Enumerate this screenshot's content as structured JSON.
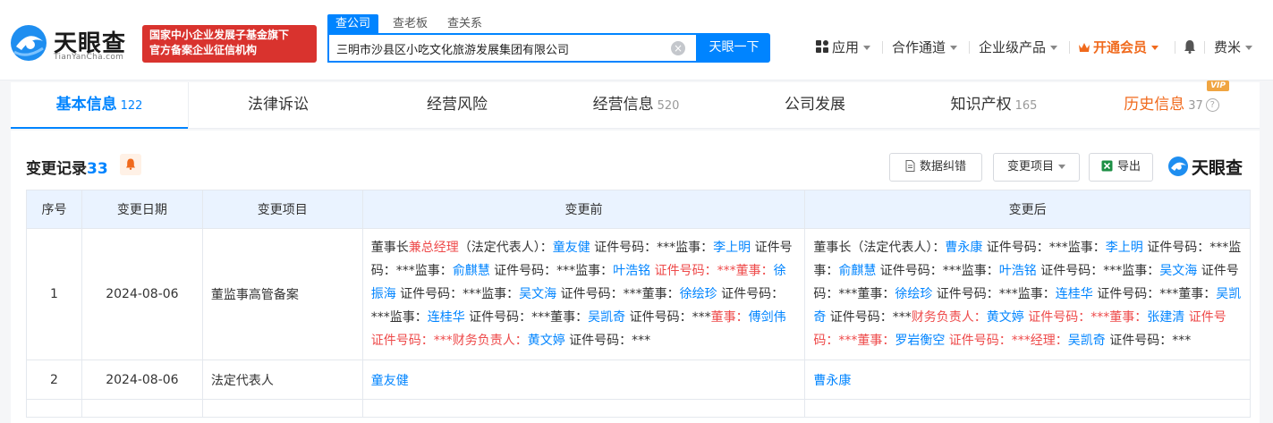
{
  "brand": {
    "name": "天眼查",
    "sub": "TianYanCha.com",
    "badge_line1": "国家中小企业发展子基金旗下",
    "badge_line2": "官方备案企业征信机构"
  },
  "search": {
    "tabs": [
      "查公司",
      "查老板",
      "查关系"
    ],
    "value": "三明市沙县区小吃文化旅游发展集团有限公司",
    "button": "天眼一下"
  },
  "nav": {
    "apps": "应用",
    "channels": "合作通道",
    "enterprise": "企业级产品",
    "vip": "开通会员",
    "user": "费米"
  },
  "tabs": [
    {
      "label": "基本信息",
      "count": "122"
    },
    {
      "label": "法律诉讼",
      "count": ""
    },
    {
      "label": "经营风险",
      "count": ""
    },
    {
      "label": "经营信息",
      "count": "520"
    },
    {
      "label": "公司发展",
      "count": ""
    },
    {
      "label": "知识产权",
      "count": "165"
    },
    {
      "label": "历史信息",
      "count": "37",
      "tag": "VIP"
    }
  ],
  "section": {
    "title": "变更记录",
    "count": "33",
    "btn_correct": "数据纠错",
    "btn_items": "变更项目",
    "btn_export": "导出",
    "brand": "天眼查"
  },
  "table": {
    "headers": [
      "序号",
      "变更日期",
      "变更项目",
      "变更前",
      "变更后"
    ],
    "rows": [
      {
        "idx": "1",
        "date": "2024-08-06",
        "item": "董监事高管备案"
      },
      {
        "idx": "2",
        "date": "2024-08-06",
        "item": "法定代表人",
        "before": "童友健",
        "after": "曹永康"
      }
    ]
  },
  "row1_before": [
    {
      "t": "董事长",
      "c": ""
    },
    {
      "t": "兼总经理",
      "c": "red"
    },
    {
      "t": "（法定代表人）：",
      "c": ""
    },
    {
      "t": "童友健",
      "c": "lnk"
    },
    {
      "t": " 证件号码：***监事：",
      "c": ""
    },
    {
      "t": "李上明",
      "c": "lnk"
    },
    {
      "t": " 证件号码：***监事：",
      "c": ""
    },
    {
      "t": "俞麒慧",
      "c": "lnk"
    },
    {
      "t": " 证件号码：***监事：",
      "c": ""
    },
    {
      "t": "叶浩铭",
      "c": "lnk"
    },
    {
      "t": " 证件号码：***董事：",
      "c": "red"
    },
    {
      "t": "徐振海",
      "c": "lnk"
    },
    {
      "t": " 证件号码：***监事：",
      "c": ""
    },
    {
      "t": "吴文海",
      "c": "lnk"
    },
    {
      "t": " 证件号码：***董事：",
      "c": ""
    },
    {
      "t": "徐绘珍",
      "c": "lnk"
    },
    {
      "t": " 证件号码：***监事：",
      "c": ""
    },
    {
      "t": "连桂华",
      "c": "lnk"
    },
    {
      "t": " 证件号码：***董事：",
      "c": ""
    },
    {
      "t": "吴凯奇",
      "c": "lnk"
    },
    {
      "t": " 证件号码：***",
      "c": ""
    },
    {
      "t": "董事：",
      "c": "red"
    },
    {
      "t": "傅剑伟",
      "c": "lnk"
    },
    {
      "t": " 证件号码：***财务负责人：",
      "c": "red"
    },
    {
      "t": "黄文婷",
      "c": "lnk"
    },
    {
      "t": " 证件号码：***",
      "c": ""
    }
  ],
  "row1_after": [
    {
      "t": "董事长（法定代表人）：",
      "c": ""
    },
    {
      "t": "曹永康",
      "c": "lnk"
    },
    {
      "t": " 证件号码：***监事：",
      "c": ""
    },
    {
      "t": "李上明",
      "c": "lnk"
    },
    {
      "t": " 证件号码：***监事：",
      "c": ""
    },
    {
      "t": "俞麒慧",
      "c": "lnk"
    },
    {
      "t": " 证件号码：***监事：",
      "c": ""
    },
    {
      "t": "叶浩铭",
      "c": "lnk"
    },
    {
      "t": " 证件号码：***监事：",
      "c": ""
    },
    {
      "t": "吴文海",
      "c": "lnk"
    },
    {
      "t": " 证件号码：***董事：",
      "c": ""
    },
    {
      "t": "徐绘珍",
      "c": "lnk"
    },
    {
      "t": " 证件号码：***监事：",
      "c": ""
    },
    {
      "t": "连桂华",
      "c": "lnk"
    },
    {
      "t": " 证件号码：***董事：",
      "c": ""
    },
    {
      "t": "吴凯奇",
      "c": "lnk"
    },
    {
      "t": " 证件号码：***",
      "c": ""
    },
    {
      "t": "财务负责人：",
      "c": "red"
    },
    {
      "t": "黄文婷",
      "c": "lnk"
    },
    {
      "t": " 证件号码：***董事：",
      "c": "red"
    },
    {
      "t": "张建清",
      "c": "lnk"
    },
    {
      "t": " 证件号码：***董事：",
      "c": "red"
    },
    {
      "t": "罗岩衡空",
      "c": "lnk"
    },
    {
      "t": " 证件号码：***经理：",
      "c": "red"
    },
    {
      "t": "吴凯奇",
      "c": "lnk"
    },
    {
      "t": " 证件号码：***",
      "c": ""
    }
  ],
  "colors": {
    "accent": "#0084ff",
    "red": "#ee4a4a",
    "orange": "#f06a1d",
    "brandRed": "#d9332e"
  }
}
